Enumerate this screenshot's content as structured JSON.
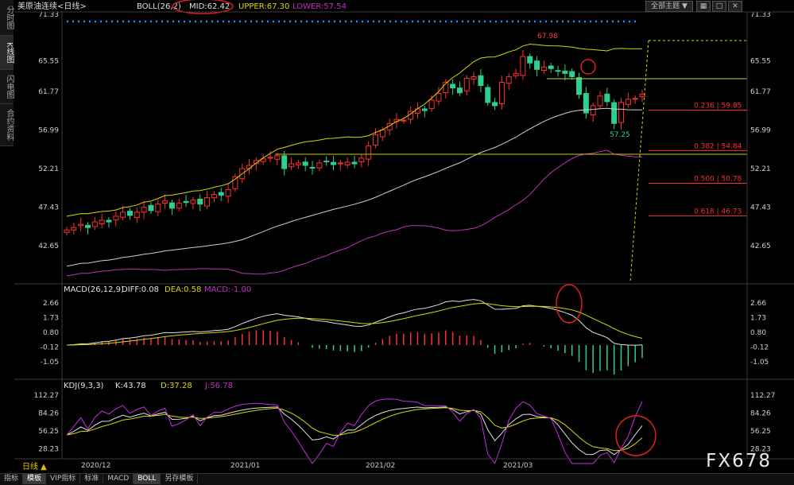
{
  "side_tabs": [
    "分时图",
    "K线图",
    "闪电图",
    "合约资料"
  ],
  "top_controls": {
    "theme_label": "全部主题 ▼",
    "icons": [
      "grid-icon",
      "maximize-icon",
      "close-icon"
    ]
  },
  "main_panel": {
    "symbol": "美原油连续<日线>",
    "indicator_name": "BOLL(26,2)",
    "mid_label": "MID:62.42",
    "upper_label": "UPPER:67.30",
    "lower_label": "LOWER:57.54",
    "y_ticks": [
      "71.33",
      "65.55",
      "61.77",
      "56.99",
      "52.21",
      "47.43",
      "42.65"
    ],
    "annotations": {
      "high": "67.98",
      "low": "57.25"
    },
    "fib_levels": [
      {
        "label": "0.236 | 59.85",
        "value": 59.85
      },
      {
        "label": "0.382 | 54.84",
        "value": 54.84
      },
      {
        "label": "0.500 | 50.78",
        "value": 50.78
      },
      {
        "label": "0.618 | 46.73",
        "value": 46.73
      }
    ],
    "colors": {
      "up": "#ff3030",
      "down": "#2ecf8f",
      "mid": "#d0d0d0",
      "upper": "#d8d800",
      "lower": "#c030c0",
      "fib": "#ff3030"
    }
  },
  "macd_panel": {
    "title": "MACD(26,12,9)",
    "diff_label": "DIFF:0.08",
    "dea_label": "DEA:0.58",
    "macd_label": "MACD:-1.00",
    "y_ticks": [
      "2.66",
      "1.73",
      "0.80",
      "-0.12",
      "-1.05"
    ]
  },
  "kdj_panel": {
    "title": "KDJ(9,3,3)",
    "k_label": "K:43.78",
    "d_label": "D:37.28",
    "j_label": "J:56.78",
    "y_ticks": [
      "112.27",
      "84.26",
      "56.25",
      "28.23"
    ]
  },
  "x_axis": {
    "period_label": "日线 ▲",
    "dates": [
      "2020/12",
      "2021/01",
      "2021/02",
      "2021/03"
    ]
  },
  "bottom_tabs": [
    "指标",
    "模板",
    "VIP指标",
    "标准",
    "MACD",
    "BOLL",
    "另存模板"
  ],
  "watermark": "FX678",
  "chart_data": {
    "type": "candlestick",
    "title": "美原油连续<日线>",
    "ylim": [
      42.65,
      71.33
    ],
    "close": [
      44.6,
      44.9,
      45.3,
      44.9,
      45.6,
      45.8,
      45.6,
      46.3,
      46.8,
      46.4,
      46.8,
      47.4,
      47.0,
      47.8,
      48.2,
      47.3,
      47.9,
      48.0,
      48.3,
      47.8,
      48.6,
      49.0,
      48.9,
      49.6,
      51.2,
      52.2,
      52.6,
      53.2,
      53.4,
      53.6,
      53.8,
      52.2,
      52.8,
      52.9,
      52.6,
      52.3,
      52.9,
      53.1,
      52.7,
      52.9,
      53.0,
      52.8,
      53.5,
      55.0,
      56.4,
      57.0,
      57.8,
      58.3,
      58.2,
      59.3,
      59.6,
      59.4,
      60.7,
      61.5,
      62.9,
      62.2,
      61.6,
      63.4,
      63.6,
      62.5,
      60.4,
      60.0,
      62.9,
      63.6,
      64.0,
      66.1,
      65.3,
      64.5,
      64.8,
      64.6,
      64.3,
      64.0,
      63.6,
      61.4,
      59.1,
      60.0,
      61.2,
      60.5,
      57.8,
      60.4,
      60.8,
      60.9,
      61.4
    ],
    "dates_shown": [
      "2020/12",
      "2021/01",
      "2021/02",
      "2021/03"
    ]
  }
}
